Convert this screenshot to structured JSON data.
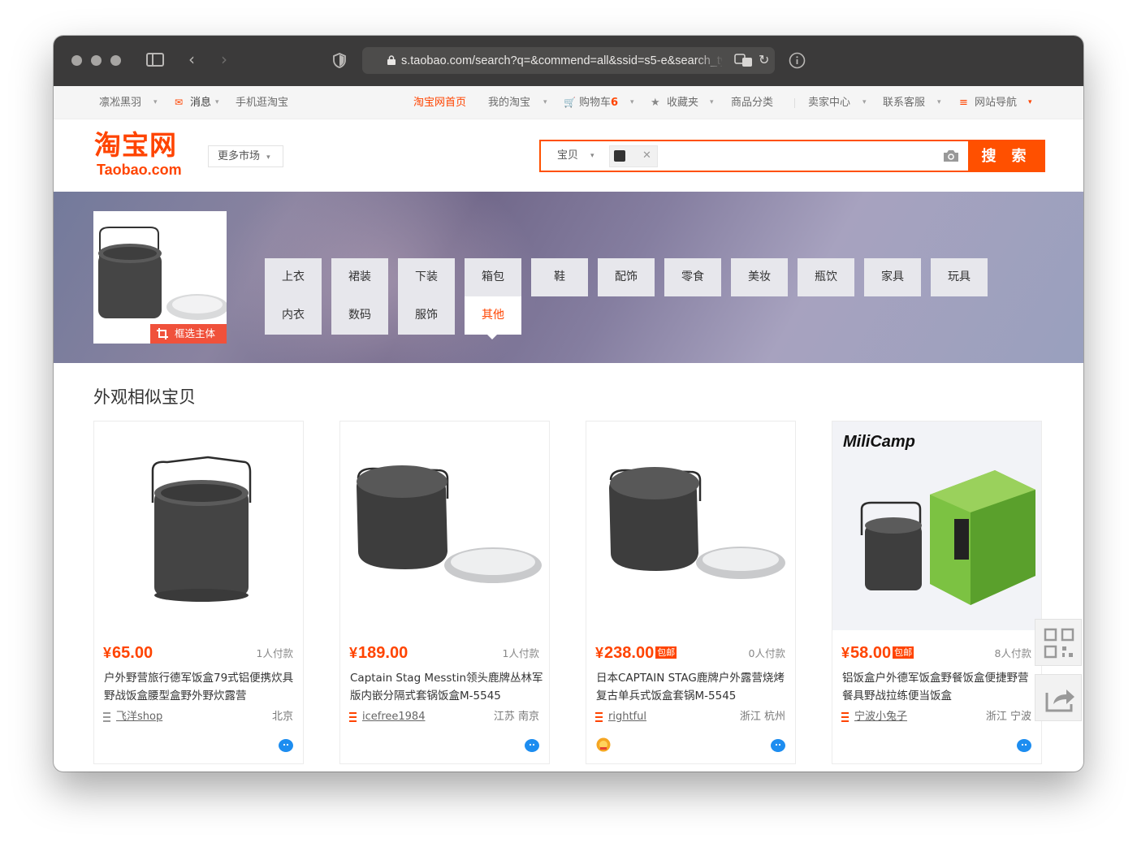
{
  "browser": {
    "url": "s.taobao.com/search?q=&commend=all&ssid=s5-e&search_type=item"
  },
  "topnav": {
    "user": "凛凇黑羽",
    "messages": "消息",
    "mobile": "手机逛淘宝",
    "home": "淘宝网首页",
    "my_taobao": "我的淘宝",
    "cart_label": "购物车",
    "cart_count": "6",
    "favorites": "收藏夹",
    "categories": "商品分类",
    "seller_center": "卖家中心",
    "customer_service": "联系客服",
    "site_nav": "网站导航"
  },
  "header": {
    "logo_cn": "淘宝网",
    "logo_en": "Taobao.com",
    "more_market": "更多市场",
    "search_type": "宝贝",
    "search_placeholder": "",
    "search_button": "搜 索"
  },
  "banner": {
    "crop_label": "框选主体",
    "categories": [
      {
        "line1": "上衣",
        "line2": "内衣"
      },
      {
        "line1": "裙装",
        "line2": "数码"
      },
      {
        "line1": "下装",
        "line2": "服饰"
      },
      {
        "line1": "箱包",
        "line2": "其他"
      },
      {
        "line1": "鞋"
      },
      {
        "line1": "配饰"
      },
      {
        "line1": "零食"
      },
      {
        "line1": "美妆"
      },
      {
        "line1": "瓶饮"
      },
      {
        "line1": "家具"
      },
      {
        "line1": "玩具"
      }
    ],
    "active_category": "其他"
  },
  "section": {
    "title": "外观相似宝贝"
  },
  "products": [
    {
      "yen": "¥",
      "price": "65.00",
      "badge": "",
      "paid": "1人付款",
      "title": "户外野营旅行德军饭盒79式铝便携炊具野战饭盒腰型盒野外野炊露营",
      "shop": "飞洋shop",
      "location": "北京"
    },
    {
      "yen": "¥",
      "price": "189.00",
      "badge": "",
      "paid": "1人付款",
      "title": "Captain Stag Messtin领头鹿牌丛林军版内嵌分隔式套锅饭盒M-5545",
      "shop": "icefree1984",
      "location": "江苏 南京"
    },
    {
      "yen": "¥",
      "price": "238.00",
      "badge": "包邮",
      "paid": "0人付款",
      "title": "日本CAPTAIN STAG鹿牌户外露营烧烤复古单兵式饭盒套锅M-5545",
      "shop": "rightful",
      "location": "浙江 杭州"
    },
    {
      "yen": "¥",
      "price": "58.00",
      "badge": "包邮",
      "paid": "8人付款",
      "title": "铝饭盒户外德军饭盒野餐饭盒便捷野营餐具野战拉练便当饭盒",
      "shop": "宁波小兔子",
      "location": "浙江 宁波",
      "brand": "MiliCamp"
    }
  ],
  "colors": {
    "accent": "#ff4400",
    "search_border": "#ff5000"
  }
}
